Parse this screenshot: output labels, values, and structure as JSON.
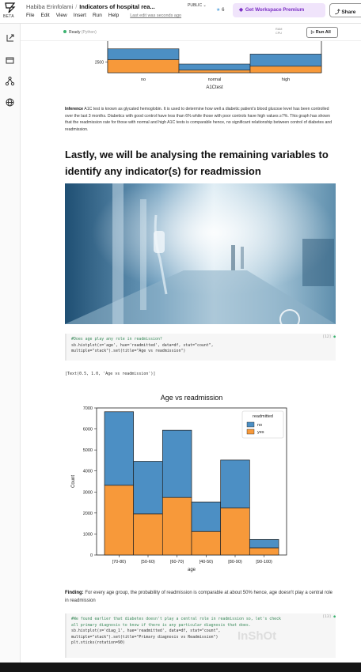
{
  "app": {
    "logo_label": "BETA",
    "owner": "Habiba Erinfolami",
    "separator": "/",
    "notebook_title": "Indicators of hospital rea...",
    "visibility": "PUBLIC",
    "menus": [
      "File",
      "Edit",
      "View",
      "Insert",
      "Run",
      "Help"
    ],
    "saved_text": "Last edit was seconds ago",
    "star_count": "6",
    "premium_label": "Get Workspace Premium",
    "share_label": "Share"
  },
  "runbar": {
    "status": "Ready",
    "kernel": "(Python)",
    "resources": [
      "RAM",
      "CPU"
    ],
    "run_all_label": "Run All"
  },
  "rail": {
    "icons": [
      "collapse-icon",
      "folder-icon",
      "share-nodes-icon",
      "globe-icon"
    ]
  },
  "top_chart_fragment": {
    "chart_data": {
      "type": "bar",
      "stacked": true,
      "x": [
        "no",
        "normal",
        "high"
      ],
      "xlabel": "A1Ctest",
      "ytick_visible": "2500",
      "series": [
        {
          "name": "no",
          "color": "#4c8fc4",
          "values": [
            2500,
            1400,
            2800
          ]
        },
        {
          "name": "yes",
          "color": "#f7993a",
          "values": [
            3000,
            600,
            1500
          ]
        }
      ]
    }
  },
  "inference": {
    "label": "Inference",
    "text": " A1C test is known as glycated hemoglobin. It is used to determine how well a diabetic patient's blood glucose level has been controlled over the last 3 months. Diabetics with good control have less than 6% while those with poor controls have high values ≥7%. This graph has shown that the readmission rate for those with normal and high A1C tests is comparable hence, no significant relationship between control of diabetes and readmission."
  },
  "heading": "Lastly, we will be analysing the remaining variables to identify any indicator(s) for readmission",
  "code1": {
    "comment": "#Does age play any role in readmission?",
    "line2": "sb.histplot(x='age', hue='readmitted', data=df, stat=\"count\",",
    "line3": "multiple=\"stack\").set(title=\"Age vs readmission\")",
    "cell_number": "[12]"
  },
  "output1": "[Text(0.5, 1.0, 'Age vs readmission')]",
  "age_chart": {
    "chart_data": {
      "type": "bar",
      "stacked": true,
      "title": "Age vs readmission",
      "xlabel": "age",
      "ylabel": "Count",
      "ylim": [
        0,
        7000
      ],
      "yticks": [
        0,
        1000,
        2000,
        3000,
        4000,
        5000,
        6000,
        7000
      ],
      "categories": [
        "[70-80)",
        "[50-60)",
        "[60-70)",
        "[40-50)",
        "[80-90)",
        "[90-100)"
      ],
      "legend_title": "readmitted",
      "legend_position": "top-right",
      "series": [
        {
          "name": "no",
          "color": "#4c8fc4",
          "values": [
            3500,
            2500,
            3200,
            1400,
            2280,
            400
          ]
        },
        {
          "name": "yes",
          "color": "#f7993a",
          "values": [
            3320,
            1960,
            2740,
            1120,
            2240,
            340
          ]
        }
      ]
    }
  },
  "finding": {
    "label": "Finding:",
    "text": " For every age group, the probability of readmission is comparable at about 50% hence, age doesn't play a central role in readmission"
  },
  "code2": {
    "comment1": "#We found earlier that diabetes doesn't play a central role in readmission so, let's check",
    "comment2": "all primary diagnosis to know if there is any particular diagnosis that does.",
    "line3": "sb.histplot(x='diag_1', hue='readmitted', data=df, stat=\"count\",",
    "line4": "multiple=\"stack\").set(title=\"Primary diagnosis vs Readmission\")",
    "line5": "plt.xticks(rotation=90)",
    "cell_number": "[13]"
  },
  "watermark": "InShOt"
}
